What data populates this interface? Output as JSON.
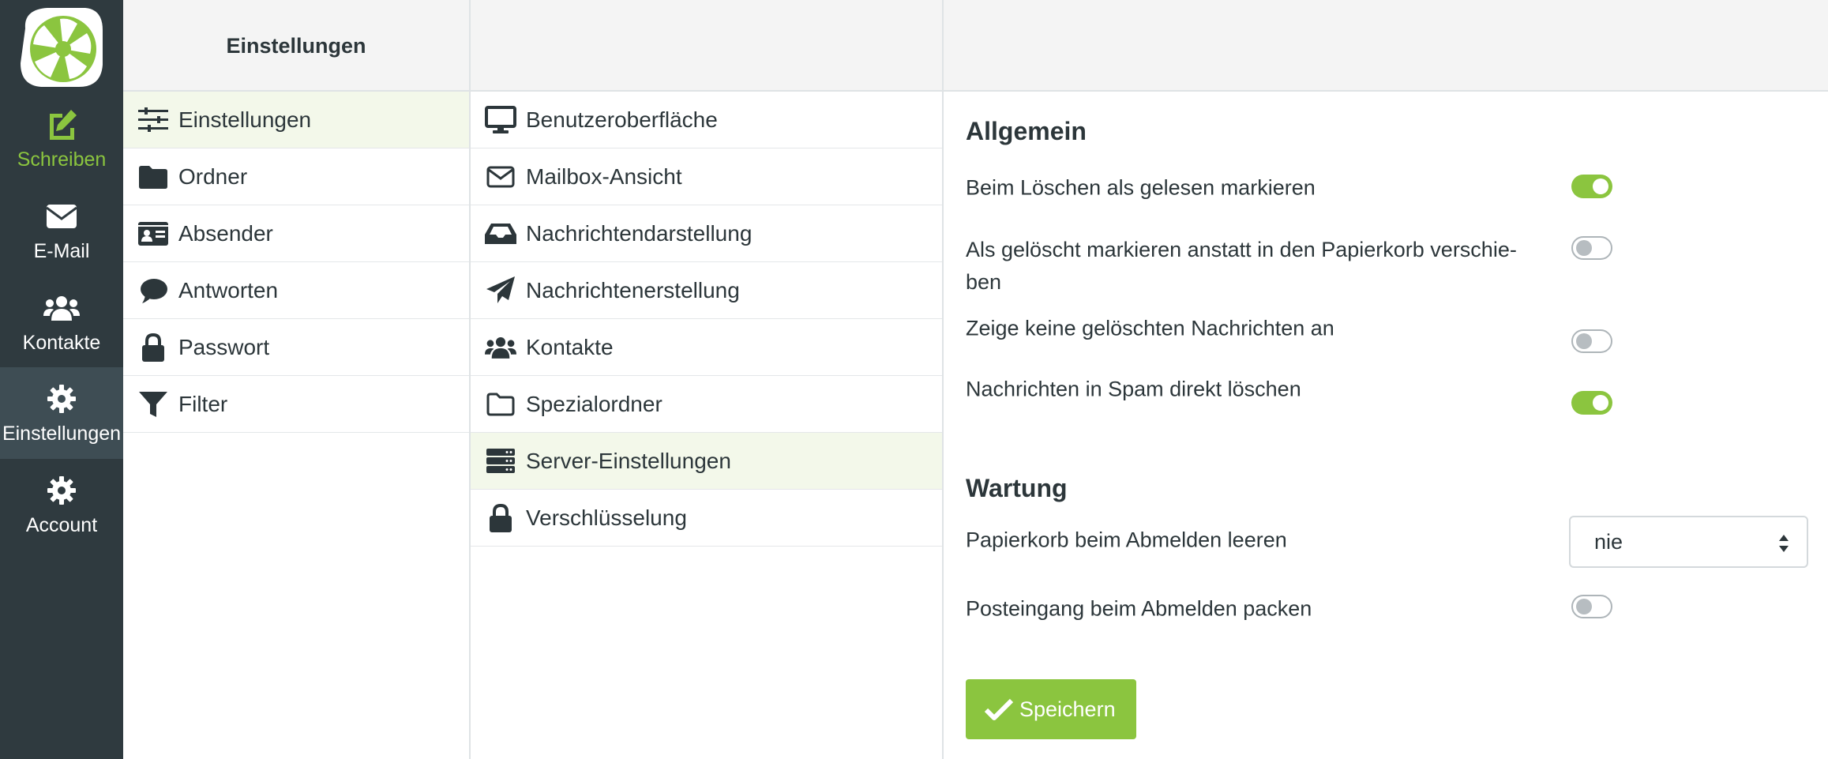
{
  "rail": {
    "items": [
      {
        "label": "Schreiben",
        "icon": "pencil-square-icon"
      },
      {
        "label": "E-Mail",
        "icon": "envelope-icon"
      },
      {
        "label": "Kontakte",
        "icon": "users-icon"
      },
      {
        "label": "Einstellungen",
        "icon": "gear-icon"
      },
      {
        "label": "Account",
        "icon": "gear-icon"
      }
    ]
  },
  "header": {
    "title": "Einstellungen"
  },
  "sections": {
    "items": [
      {
        "label": "Einstellungen",
        "icon": "sliders-icon"
      },
      {
        "label": "Ordner",
        "icon": "folder-icon"
      },
      {
        "label": "Absender",
        "icon": "id-card-icon"
      },
      {
        "label": "Antworten",
        "icon": "comment-icon"
      },
      {
        "label": "Passwort",
        "icon": "lock-icon"
      },
      {
        "label": "Filter",
        "icon": "filter-icon"
      }
    ]
  },
  "subsections": {
    "items": [
      {
        "label": "Benutzeroberfläche",
        "icon": "monitor-icon"
      },
      {
        "label": "Mailbox-Ansicht",
        "icon": "envelope-outline-icon"
      },
      {
        "label": "Nachrichtendarstellung",
        "icon": "inbox-icon"
      },
      {
        "label": "Nachrichtenerstellung",
        "icon": "paper-plane-icon"
      },
      {
        "label": "Kontakte",
        "icon": "users-icon"
      },
      {
        "label": "Spezialordner",
        "icon": "folder-outline-icon"
      },
      {
        "label": "Server-Einstellungen",
        "icon": "server-icon"
      },
      {
        "label": "Verschlüsselung",
        "icon": "lock-icon"
      }
    ]
  },
  "content": {
    "general_title": "Allgemein",
    "options": [
      {
        "label": "Beim Löschen als gelesen markieren",
        "enabled": true
      },
      {
        "label": "Als gelöscht markieren anstatt in den Papierkorb verschie-ben",
        "enabled": false
      },
      {
        "label": "Zeige keine gelöschten Nachrichten an",
        "enabled": false
      },
      {
        "label": "Nachrichten in Spam direkt löschen",
        "enabled": true
      }
    ],
    "maintenance_title": "Wartung",
    "empty_trash_label": "Papierkorb beim Abmelden leeren",
    "empty_trash_value": "nie",
    "compact_inbox_label": "Posteingang beim Abmelden packen",
    "compact_inbox_enabled": false,
    "save_label": "Speichern"
  },
  "colors": {
    "accent": "#8bc53f",
    "rail_bg": "#2f3a3f",
    "rail_selected": "#3e4d54",
    "selected_row": "#f3f8ea"
  }
}
